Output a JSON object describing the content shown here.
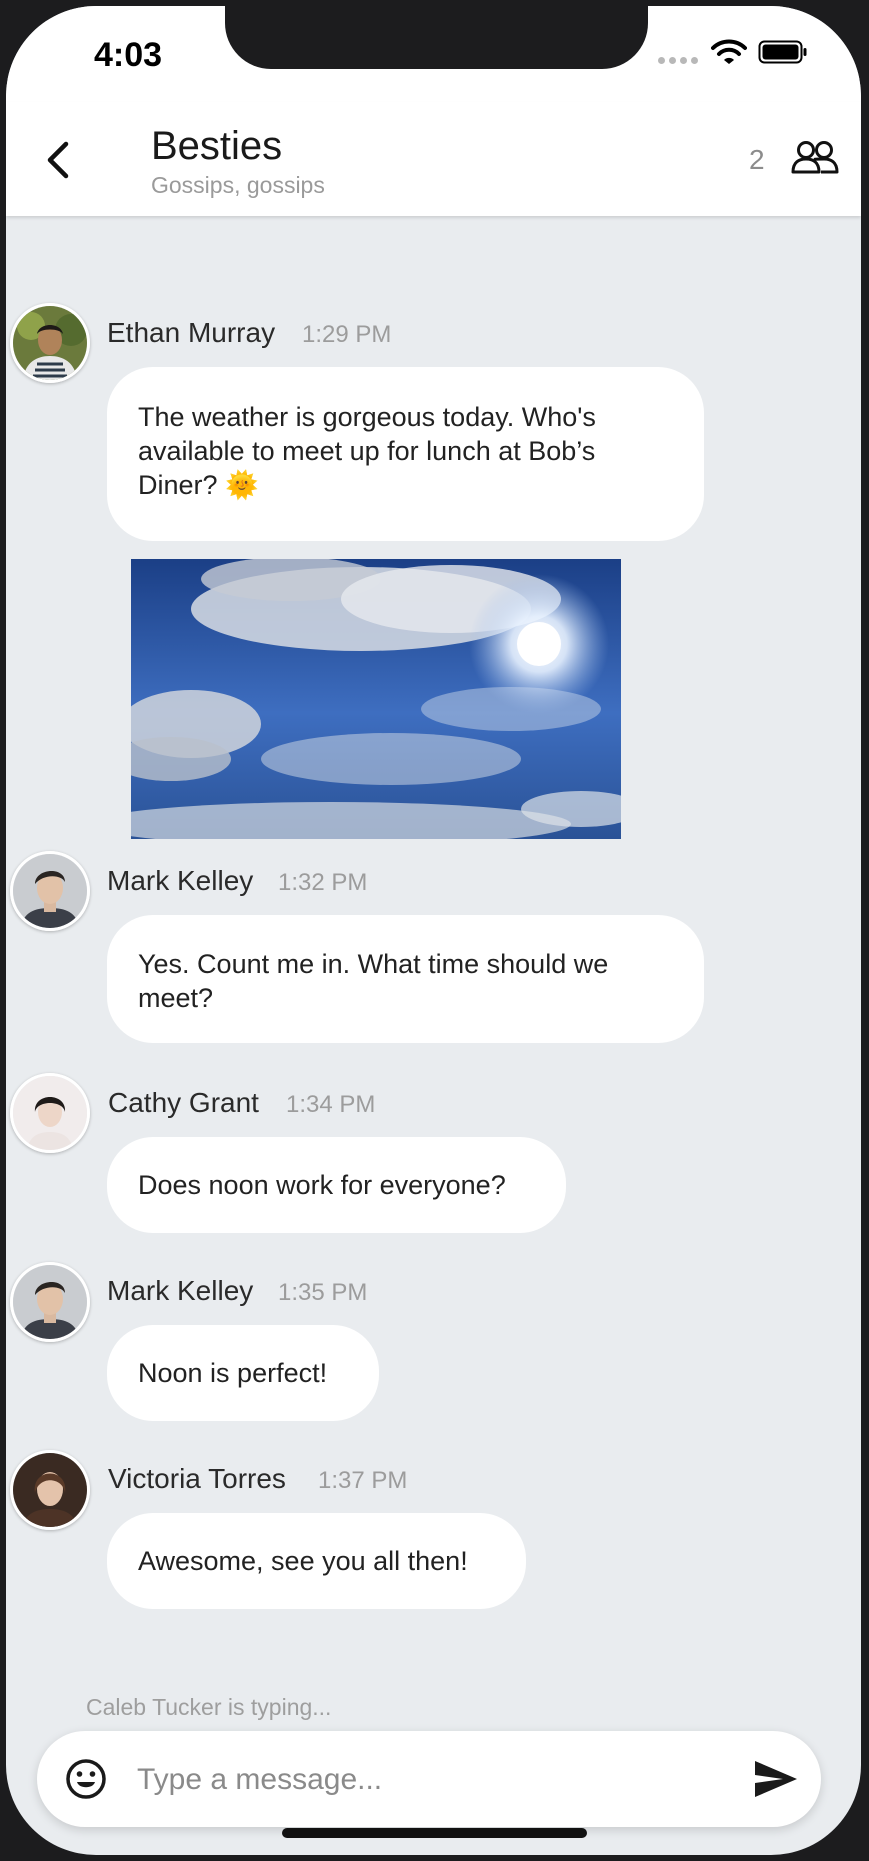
{
  "status": {
    "time": "4:03"
  },
  "header": {
    "title": "Besties",
    "subtitle": "Gossips, gossips",
    "member_count": "2"
  },
  "messages": [
    {
      "author": "Ethan Murray",
      "time": "1:29 PM",
      "text": "The weather is gorgeous today. Who's available to meet up for lunch at Bob’s Diner? 🌞",
      "image": "sky-clouds-photo"
    },
    {
      "author": "Mark Kelley",
      "time": "1:32 PM",
      "text": "Yes. Count me in. What time should we meet?"
    },
    {
      "author": "Cathy Grant",
      "time": "1:34 PM",
      "text": "Does noon work for everyone?"
    },
    {
      "author": "Mark Kelley",
      "time": "1:35 PM",
      "text": "Noon is perfect!"
    },
    {
      "author": "Victoria Torres",
      "time": "1:37 PM",
      "text": "Awesome, see you all then!"
    }
  ],
  "typing_indicator": "Caleb Tucker is typing...",
  "composer": {
    "placeholder": "Type a message..."
  },
  "icons": {
    "back": "chevron-left-icon",
    "members": "group-icon",
    "emoji": "smiley-icon",
    "send": "send-icon"
  },
  "colors": {
    "background": "#e9ecef",
    "bubble": "#ffffff",
    "header": "#ffffff"
  }
}
